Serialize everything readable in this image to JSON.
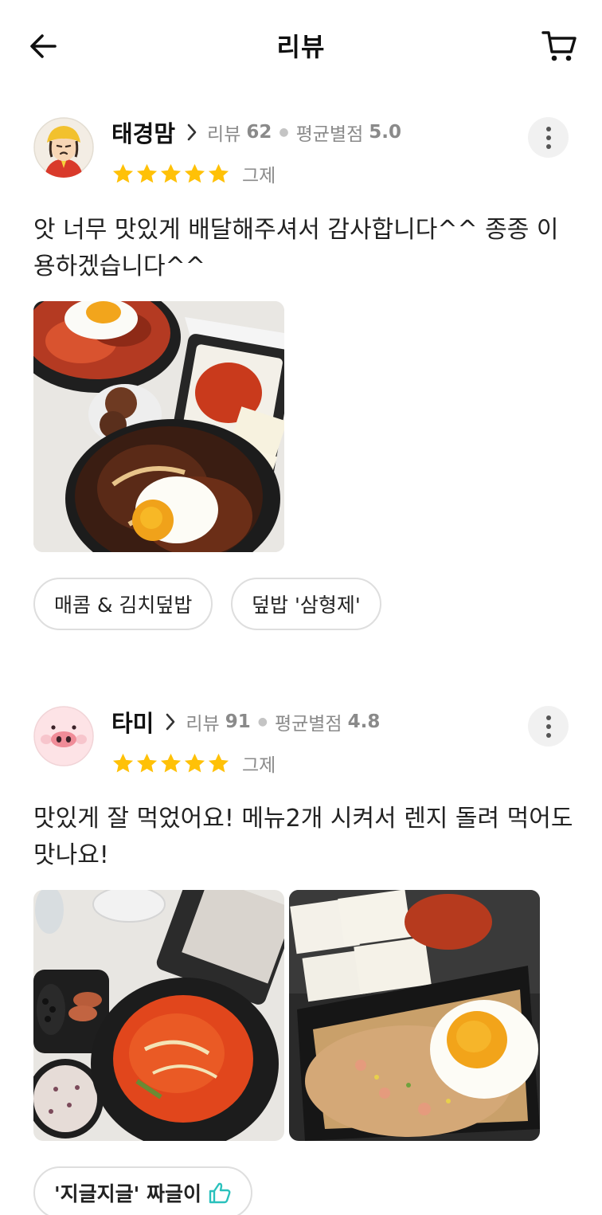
{
  "header": {
    "title": "리뷰"
  },
  "reviews": [
    {
      "name": "태경맘",
      "review_label": "리뷰",
      "review_count": "62",
      "avg_label": "평균별점",
      "avg_rating": "5.0",
      "stars": 5,
      "when": "그제",
      "text": "앗 너무 맛있게 배달해주셔서 감사합니다^^ 종종 이용하겠습니다^^",
      "tags": [
        "매콤 & 김치덮밥",
        "덮밥 '삼형제'"
      ]
    },
    {
      "name": "타미",
      "review_label": "리뷰",
      "review_count": "91",
      "avg_label": "평균별점",
      "avg_rating": "4.8",
      "stars": 5,
      "when": "그제",
      "text": "맛있게 잘 먹었어요! 메뉴2개 시켜서 렌지 돌려 먹어도 맛나요!",
      "tags": [
        "'지글지글' 짜글이"
      ]
    }
  ],
  "colors": {
    "star": "#ffc107",
    "accent": "#2ac1bc",
    "chip_border": "#dedede"
  },
  "icons": {
    "back": "arrow-left-icon",
    "cart": "cart-icon",
    "more": "more-vertical-icon",
    "chevron": "chevron-right-icon",
    "thumb": "thumbs-up-icon"
  }
}
